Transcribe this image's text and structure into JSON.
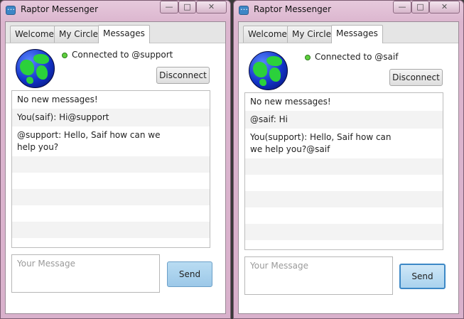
{
  "windows": [
    {
      "title": "Raptor Messenger",
      "controls": {
        "minimize": "—",
        "maximize": "□",
        "close": "✕"
      },
      "tabs": [
        {
          "label": "Welcome"
        },
        {
          "label": "My Circle"
        },
        {
          "label": "Messages"
        }
      ],
      "active_tab": "Messages",
      "status_text": "Connected to @support",
      "disconnect_label": "Disconnect",
      "messages": [
        "No new messages!",
        "You(saif): Hi@support",
        "@support: Hello, Saif how can we help you?"
      ],
      "input_placeholder": "Your Message",
      "send_label": "Send"
    },
    {
      "title": "Raptor Messenger",
      "controls": {
        "minimize": "—",
        "maximize": "□",
        "close": "✕"
      },
      "tabs": [
        {
          "label": "Welcome"
        },
        {
          "label": "My Circle"
        },
        {
          "label": "Messages"
        }
      ],
      "active_tab": "Messages",
      "status_text": "Connected to @saif",
      "disconnect_label": "Disconnect",
      "messages": [
        "No new messages!",
        "@saif: Hi",
        "You(support): Hello, Saif how can we help you?@saif"
      ],
      "input_placeholder": "Your Message",
      "send_label": "Send"
    }
  ],
  "colors": {
    "status_connected": "#5fcf3e",
    "send_button": "#a9d2ee",
    "frame": "#dcb6cf"
  }
}
